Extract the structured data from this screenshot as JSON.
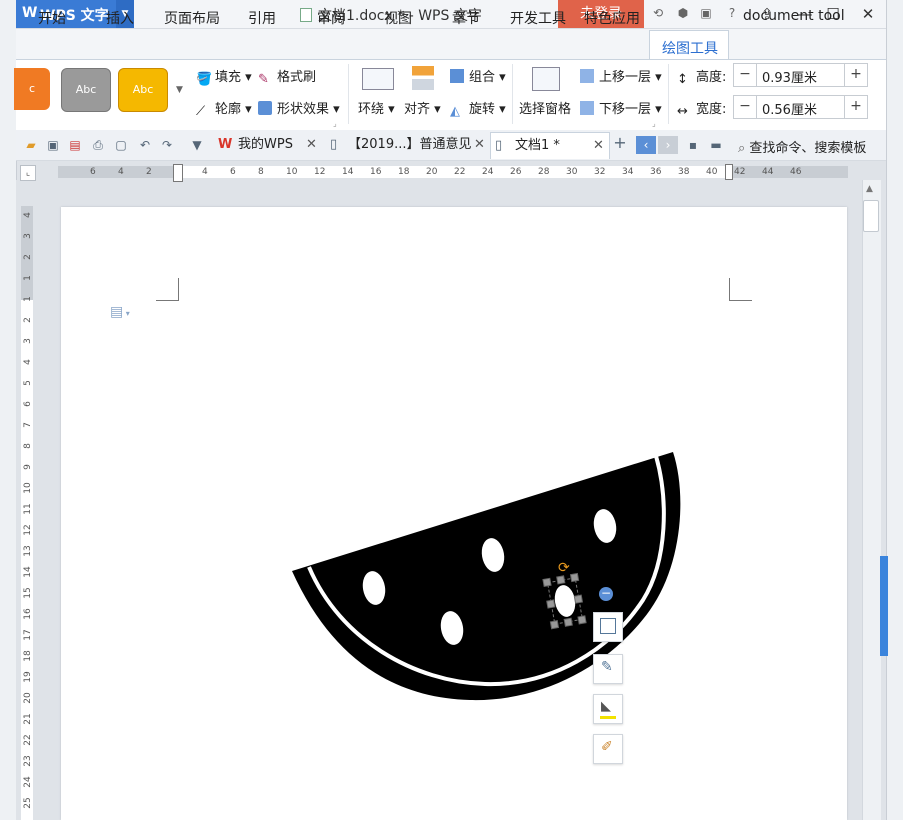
{
  "titlebar": {
    "app_logo": "W",
    "app_name": "WPS 文字",
    "doc_title": "文档1.docx * - WPS 文字",
    "login": "未登录"
  },
  "menu": {
    "tabs": [
      "开始",
      "插入",
      "页面布局",
      "引用",
      "审阅",
      "视图",
      "章节",
      "开发工具",
      "特色应用",
      "绘图工具",
      "document tool"
    ],
    "active": "绘图工具"
  },
  "ribbon": {
    "styles": [
      {
        "label": "c",
        "color": "#f07a23"
      },
      {
        "label": "Abc",
        "color": "#9a9a9a"
      },
      {
        "label": "Abc",
        "color": "#f5b800"
      }
    ],
    "fill": "填充",
    "format_painter": "格式刷",
    "outline": "轮廓",
    "shape_effect": "形状效果",
    "wrap": "环绕",
    "align": "对齐",
    "group": "组合",
    "rotate": "旋转",
    "selection_pane": "选择窗格",
    "bring_forward": "上移一层",
    "send_backward": "下移一层",
    "height_label": "高度:",
    "height_value": "0.93厘米",
    "width_label": "宽度:",
    "width_value": "0.56厘米"
  },
  "doc_tabs": [
    {
      "label": "我的WPS"
    },
    {
      "label": "【2019...】普通意见"
    },
    {
      "label": "文档1 *"
    }
  ],
  "search_placeholder": "查找命令、搜索模板",
  "ruler": {
    "h_ticks": [
      "6",
      "4",
      "2",
      "2",
      "4",
      "6",
      "8",
      "10",
      "12",
      "14",
      "16",
      "18",
      "20",
      "22",
      "24",
      "26",
      "28",
      "30",
      "32",
      "34",
      "36",
      "38",
      "40",
      "42",
      "44",
      "46"
    ],
    "v_ticks": [
      "4",
      "3",
      "2",
      "1",
      "1",
      "2",
      "3",
      "4",
      "5",
      "6",
      "7",
      "8",
      "9",
      "10",
      "11",
      "12",
      "13",
      "14",
      "15",
      "16",
      "17",
      "18",
      "19",
      "20",
      "21",
      "22",
      "23",
      "24",
      "25"
    ]
  },
  "colors": {
    "accent": "#3a7bd5",
    "login_bg": "#e0634a",
    "watermelon": "#000000"
  },
  "float_toolbar": [
    "layout-icon",
    "edit-shape-icon",
    "fill-icon",
    "outline-icon"
  ]
}
